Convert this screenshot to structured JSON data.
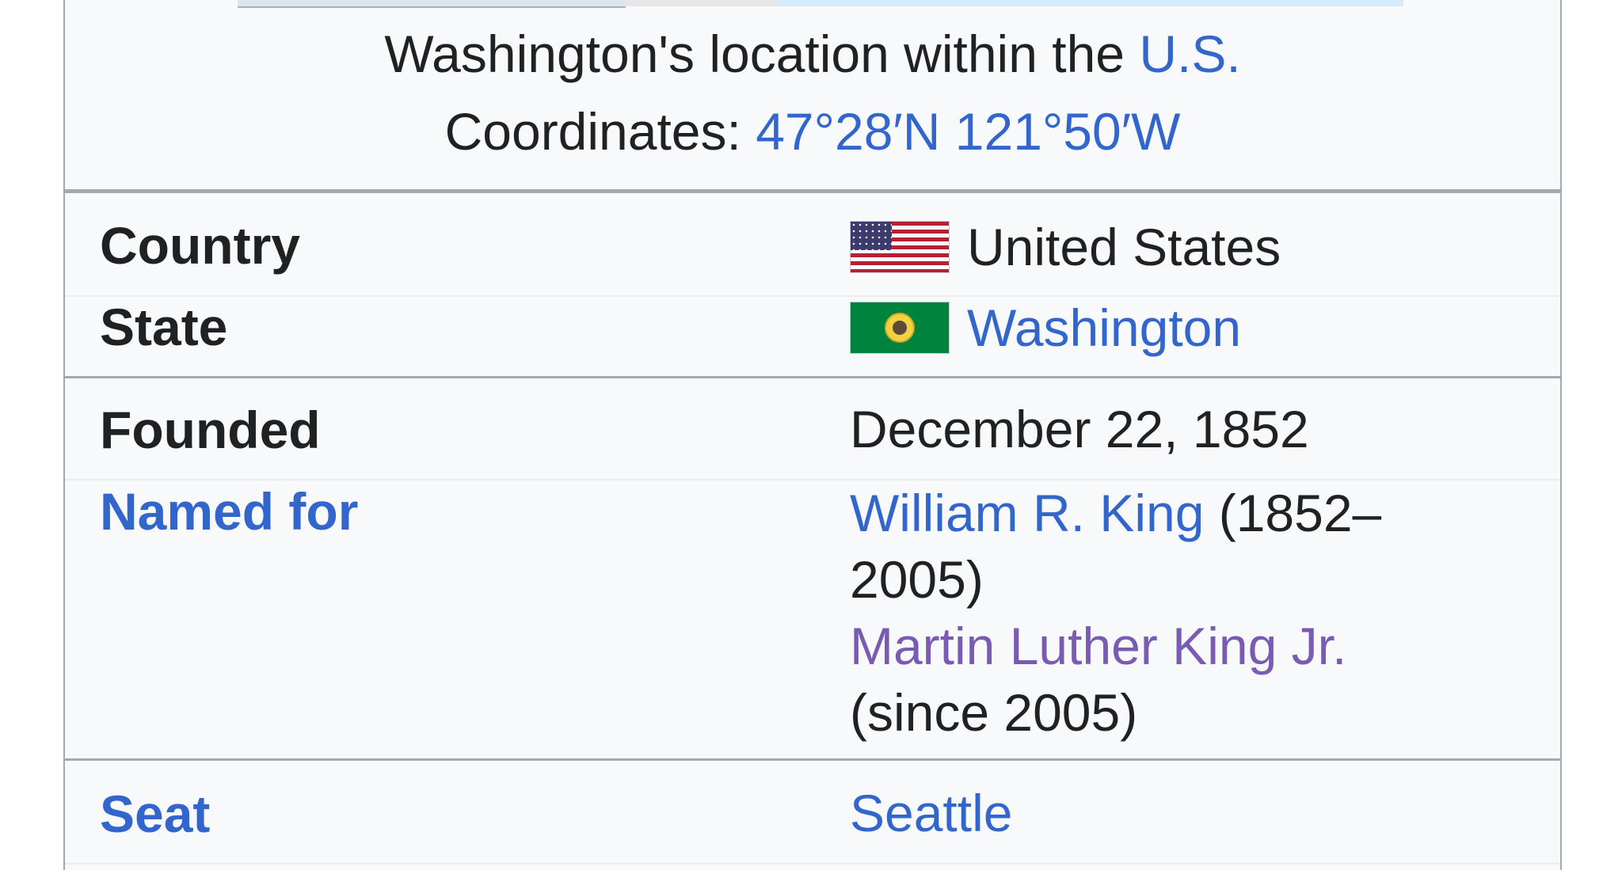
{
  "caption": {
    "location_text": "Washington's location within the ",
    "location_link": "U.S.",
    "coordinates_label": "Coordinates: ",
    "coordinates_value": "47°28′N 121°50′W"
  },
  "rows": {
    "country": {
      "label": "Country",
      "value": "United States",
      "flag_icon": "us-flag-icon"
    },
    "state": {
      "label": "State",
      "value": "Washington",
      "flag_icon": "washington-flag-icon"
    },
    "founded": {
      "label": "Founded",
      "value": "December 22, 1852"
    },
    "named_for": {
      "label": "Named for",
      "person1": "William R. King",
      "person1_note": " (1852–2005)",
      "person2": "Martin Luther King Jr.",
      "person2_note": "(since 2005)"
    },
    "seat": {
      "label": "Seat",
      "value": "Seattle"
    }
  },
  "colors": {
    "link": "#3366cc",
    "visited_link": "#795cb2",
    "text": "#202122",
    "background": "#f8f9fa",
    "border": "#a2a9b1"
  }
}
